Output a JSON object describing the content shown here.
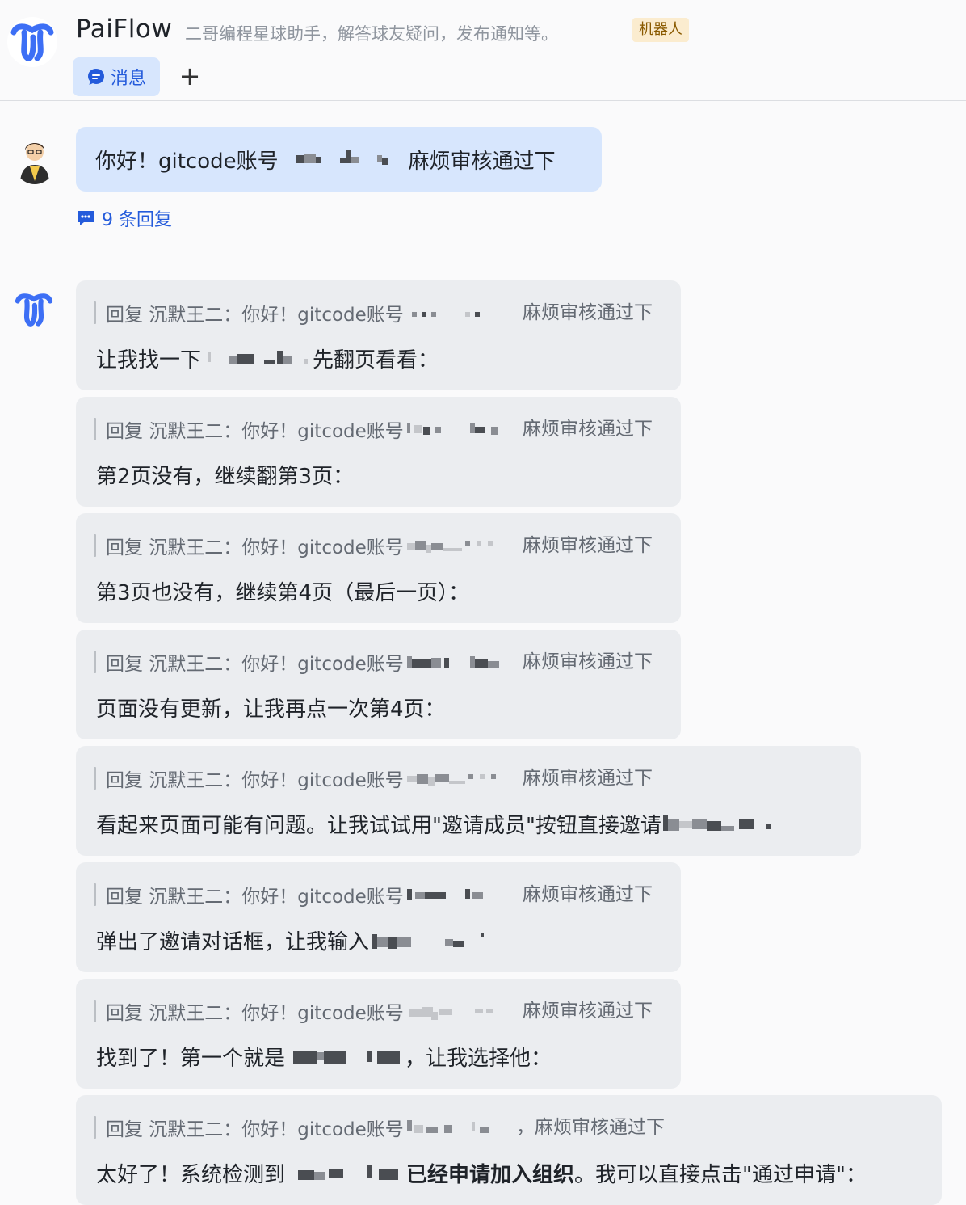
{
  "header": {
    "bot_name": "PaiFlow",
    "description": "二哥编程星球助手，解答球友疑问，发布通知等。",
    "badge": "机器人",
    "tab_message": "消息",
    "add_tab_symbol": "+"
  },
  "thread": {
    "root": {
      "text_before": "你好！gitcode账号",
      "text_after": "麻烦审核通过下"
    },
    "replies_link": "9 条回复"
  },
  "quote": {
    "prefix": "回复 沉默王二：你好！gitcode账号",
    "suffix": "麻烦审核通过下",
    "suffix_comma": "，麻烦审核通过下"
  },
  "replies": [
    {
      "before": "让我找一下",
      "after": "先翻页看看："
    },
    {
      "text": "第2页没有，继续翻第3页："
    },
    {
      "text": "第3页也没有，继续第4页（最后一页）："
    },
    {
      "text": "页面没有更新，让我再点一次第4页："
    },
    {
      "before": "看起来页面可能有问题。让我试试用\"邀请成员\"按钮直接邀请"
    },
    {
      "before": "弹出了邀请对话框，让我输入"
    },
    {
      "before": "找到了！第一个就是",
      "after": "，让我选择他："
    },
    {
      "before": "太好了！系统检测到",
      "bold": "已经申请加入组织",
      "after": "。我可以直接点击\"通过申请\"："
    }
  ],
  "colors": {
    "accent": "#245bdb",
    "user_bubble": "#d7e6fd",
    "reply_bubble": "#ebedf0",
    "badge_bg": "#fbeccf",
    "badge_text": "#8a5a00",
    "page_bg": "#fafafb"
  },
  "icons": {
    "bot_logo": "paiflow-logo-icon",
    "tab_message": "chat-bubble-icon",
    "add_tab": "plus-icon",
    "replies": "thread-replies-icon"
  }
}
